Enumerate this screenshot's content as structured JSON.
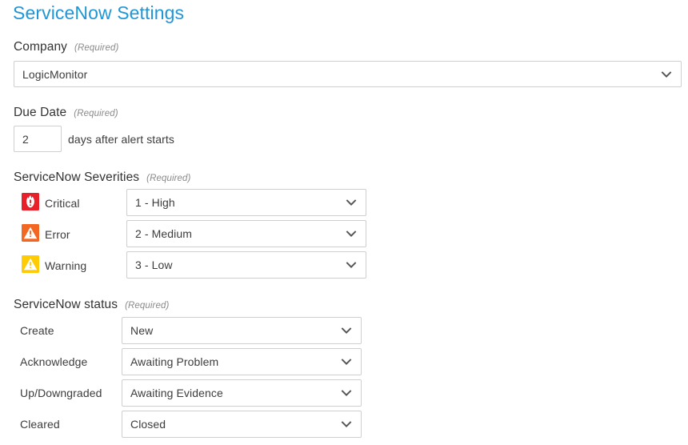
{
  "page": {
    "title": "ServiceNow Settings",
    "title_color": "#2196d6",
    "required_label": "(Required)"
  },
  "company": {
    "heading": "Company",
    "required": "(Required)",
    "selected": "LogicMonitor",
    "chevron_icon": "chevron-down-icon"
  },
  "due_date": {
    "heading": "Due Date",
    "required": "(Required)",
    "value": "2",
    "suffix": "days after alert starts"
  },
  "severities": {
    "heading": "ServiceNow Severities",
    "required": "(Required)",
    "rows": [
      {
        "label": "Critical",
        "icon": "critical-flame-icon",
        "icon_color": "#e8202a",
        "selected": "1 - High"
      },
      {
        "label": "Error",
        "icon": "error-warning-triangle-icon",
        "icon_color": "#f26722",
        "selected": "2 - Medium"
      },
      {
        "label": "Warning",
        "icon": "warning-triangle-icon",
        "icon_color": "#ffcb05",
        "selected": "3 - Low"
      }
    ]
  },
  "status": {
    "heading": "ServiceNow status",
    "required": "(Required)",
    "rows": [
      {
        "label": "Create",
        "selected": "New"
      },
      {
        "label": "Acknowledge",
        "selected": "Awaiting Problem"
      },
      {
        "label": "Up/Downgraded",
        "selected": "Awaiting Evidence"
      },
      {
        "label": "Cleared",
        "selected": "Closed"
      }
    ]
  }
}
